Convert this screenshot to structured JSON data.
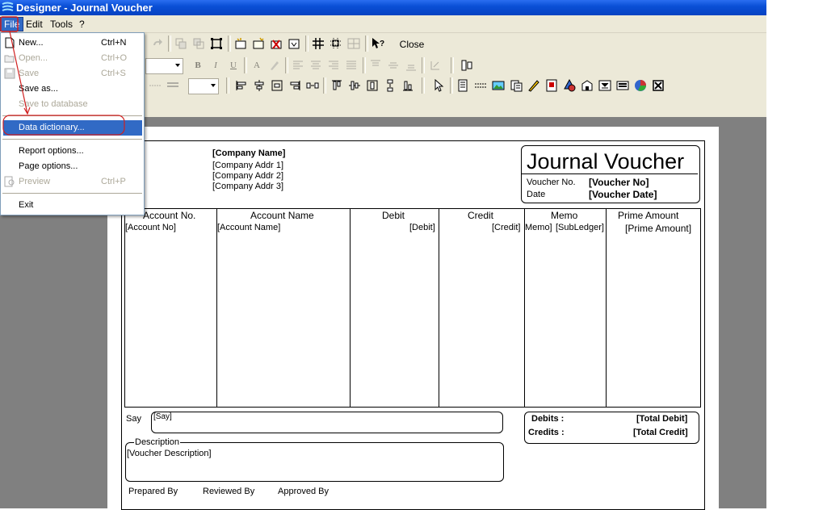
{
  "window": {
    "title": "Designer - Journal Voucher"
  },
  "menubar": {
    "items": [
      "File",
      "Edit",
      "Tools",
      "?"
    ]
  },
  "toolbar": {
    "close_label": "Close"
  },
  "file_menu": {
    "items": [
      {
        "label": "New...",
        "shortcut": "Ctrl+N",
        "icon": "new-file-icon"
      },
      {
        "label": "Open...",
        "shortcut": "Ctrl+O",
        "icon": "open-folder-icon"
      },
      {
        "label": "Save",
        "shortcut": "Ctrl+S",
        "icon": "save-icon"
      },
      {
        "label": "Save as...",
        "shortcut": ""
      },
      {
        "label": "Save to database",
        "shortcut": ""
      },
      {
        "label": "Data dictionary...",
        "shortcut": ""
      },
      {
        "label": "Report options...",
        "shortcut": ""
      },
      {
        "label": "Page options...",
        "shortcut": ""
      },
      {
        "label": "Preview",
        "shortcut": "Ctrl+P",
        "icon": "preview-icon"
      },
      {
        "label": "Exit",
        "shortcut": ""
      }
    ]
  },
  "report": {
    "company_name": "[Company Name]",
    "company_addr1": "[Company Addr 1]",
    "company_addr2": "[Company Addr 2]",
    "company_addr3": "[Company Addr 3]",
    "title": "Journal Voucher",
    "voucher_no_label": "Voucher No.",
    "voucher_no_value": "[Voucher No]",
    "date_label": "Date",
    "date_value": "[Voucher Date]",
    "columns": [
      "Account No.",
      "Account Name",
      "Debit",
      "Credit",
      "Memo",
      "Prime Amount"
    ],
    "fields": {
      "account_no": "[Account No]",
      "account_name": "[Account Name]",
      "debit": "[Debit]",
      "credit": "[Credit]",
      "memo": "Memo]",
      "subledger": "[SubLedger]",
      "prime_amount": "[Prime Amount]"
    },
    "say_label": "Say",
    "say_value": "[Say]",
    "description_label": "Description",
    "description_value": "[Voucher Description]",
    "debits_label": "Debits :",
    "total_debit": "[Total Debit]",
    "credits_label": "Credits :",
    "total_credit": "[Total Credit]",
    "prepared_by": "Prepared By",
    "reviewed_by": "Reviewed By",
    "approved_by": "Approved By"
  }
}
